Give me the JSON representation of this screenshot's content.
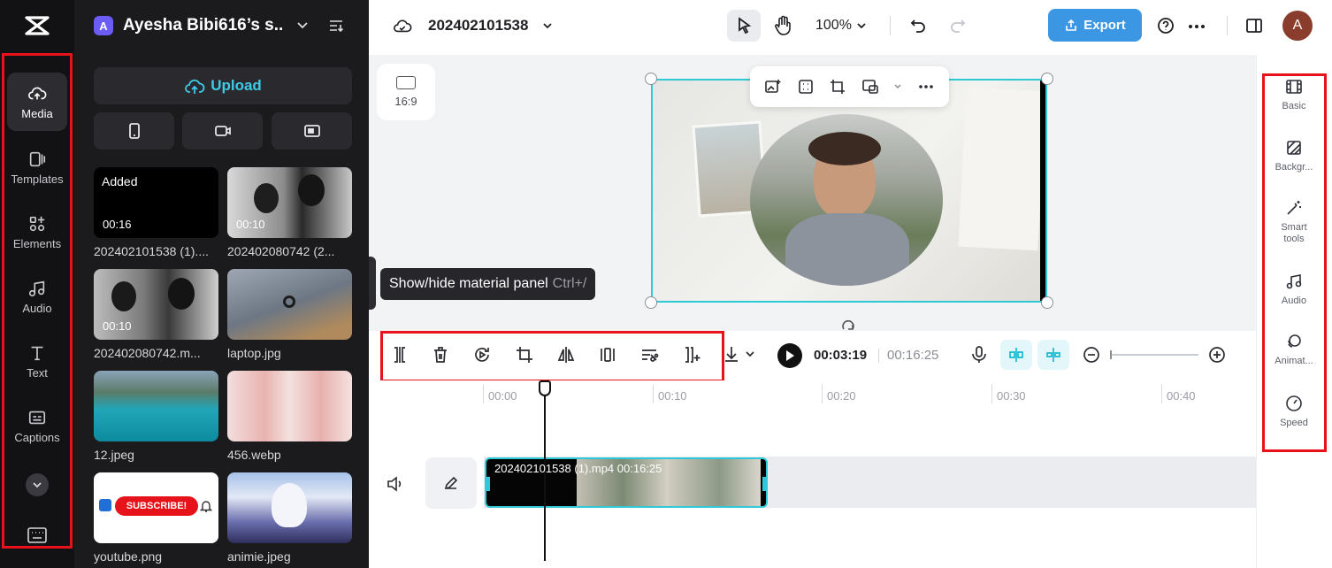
{
  "rail": {
    "items": [
      {
        "label": "Media",
        "icon": "cloud-upload-icon"
      },
      {
        "label": "Templates",
        "icon": "templates-icon"
      },
      {
        "label": "Elements",
        "icon": "elements-icon"
      },
      {
        "label": "Audio",
        "icon": "music-note-icon"
      },
      {
        "label": "Text",
        "icon": "text-icon"
      },
      {
        "label": "Captions",
        "icon": "captions-icon"
      }
    ]
  },
  "panel": {
    "workspace_badge": "A",
    "workspace_name": "Ayesha Bibi616’s s...",
    "upload_label": "Upload",
    "media": [
      {
        "name": "202402101538 (1)....",
        "duration": "00:16",
        "status": "Added"
      },
      {
        "name": "202402080742 (2...",
        "duration": "00:10"
      },
      {
        "name": "202402080742.m...",
        "duration": "00:10"
      },
      {
        "name": "laptop.jpg"
      },
      {
        "name": "12.jpeg"
      },
      {
        "name": "456.webp"
      },
      {
        "name": "youtube.png",
        "overlay_text": "SUBSCRIBE!"
      },
      {
        "name": "animie.jpeg"
      }
    ]
  },
  "topbar": {
    "project_title": "202402101538",
    "zoom": "100%",
    "export_label": "Export",
    "avatar_initial": "A"
  },
  "canvas": {
    "ratio_label": "16:9",
    "tooltip": "Show/hide material panel",
    "tooltip_shortcut": "Ctrl+/"
  },
  "properties": {
    "items": [
      {
        "label": "Basic",
        "icon": "film-strip-icon"
      },
      {
        "label": "Backgr...",
        "icon": "background-icon"
      },
      {
        "label": "Smart tools",
        "icon": "magic-wand-icon"
      },
      {
        "label": "Audio",
        "icon": "music-note-icon"
      },
      {
        "label": "Animat...",
        "icon": "animation-icon"
      },
      {
        "label": "Speed",
        "icon": "speed-icon"
      }
    ]
  },
  "timeline": {
    "current_time": "00:03:19",
    "total_time": "00:16:25",
    "ruler": [
      "00:00",
      "00:10",
      "00:20",
      "00:30",
      "00:40"
    ],
    "clip_label": "202402101538 (1).mp4   00:16:25"
  },
  "colors": {
    "accent": "#2ec8d6",
    "export": "#3b97e3",
    "highlight": "#e8121c",
    "dark_panel": "#1b1b1e"
  }
}
